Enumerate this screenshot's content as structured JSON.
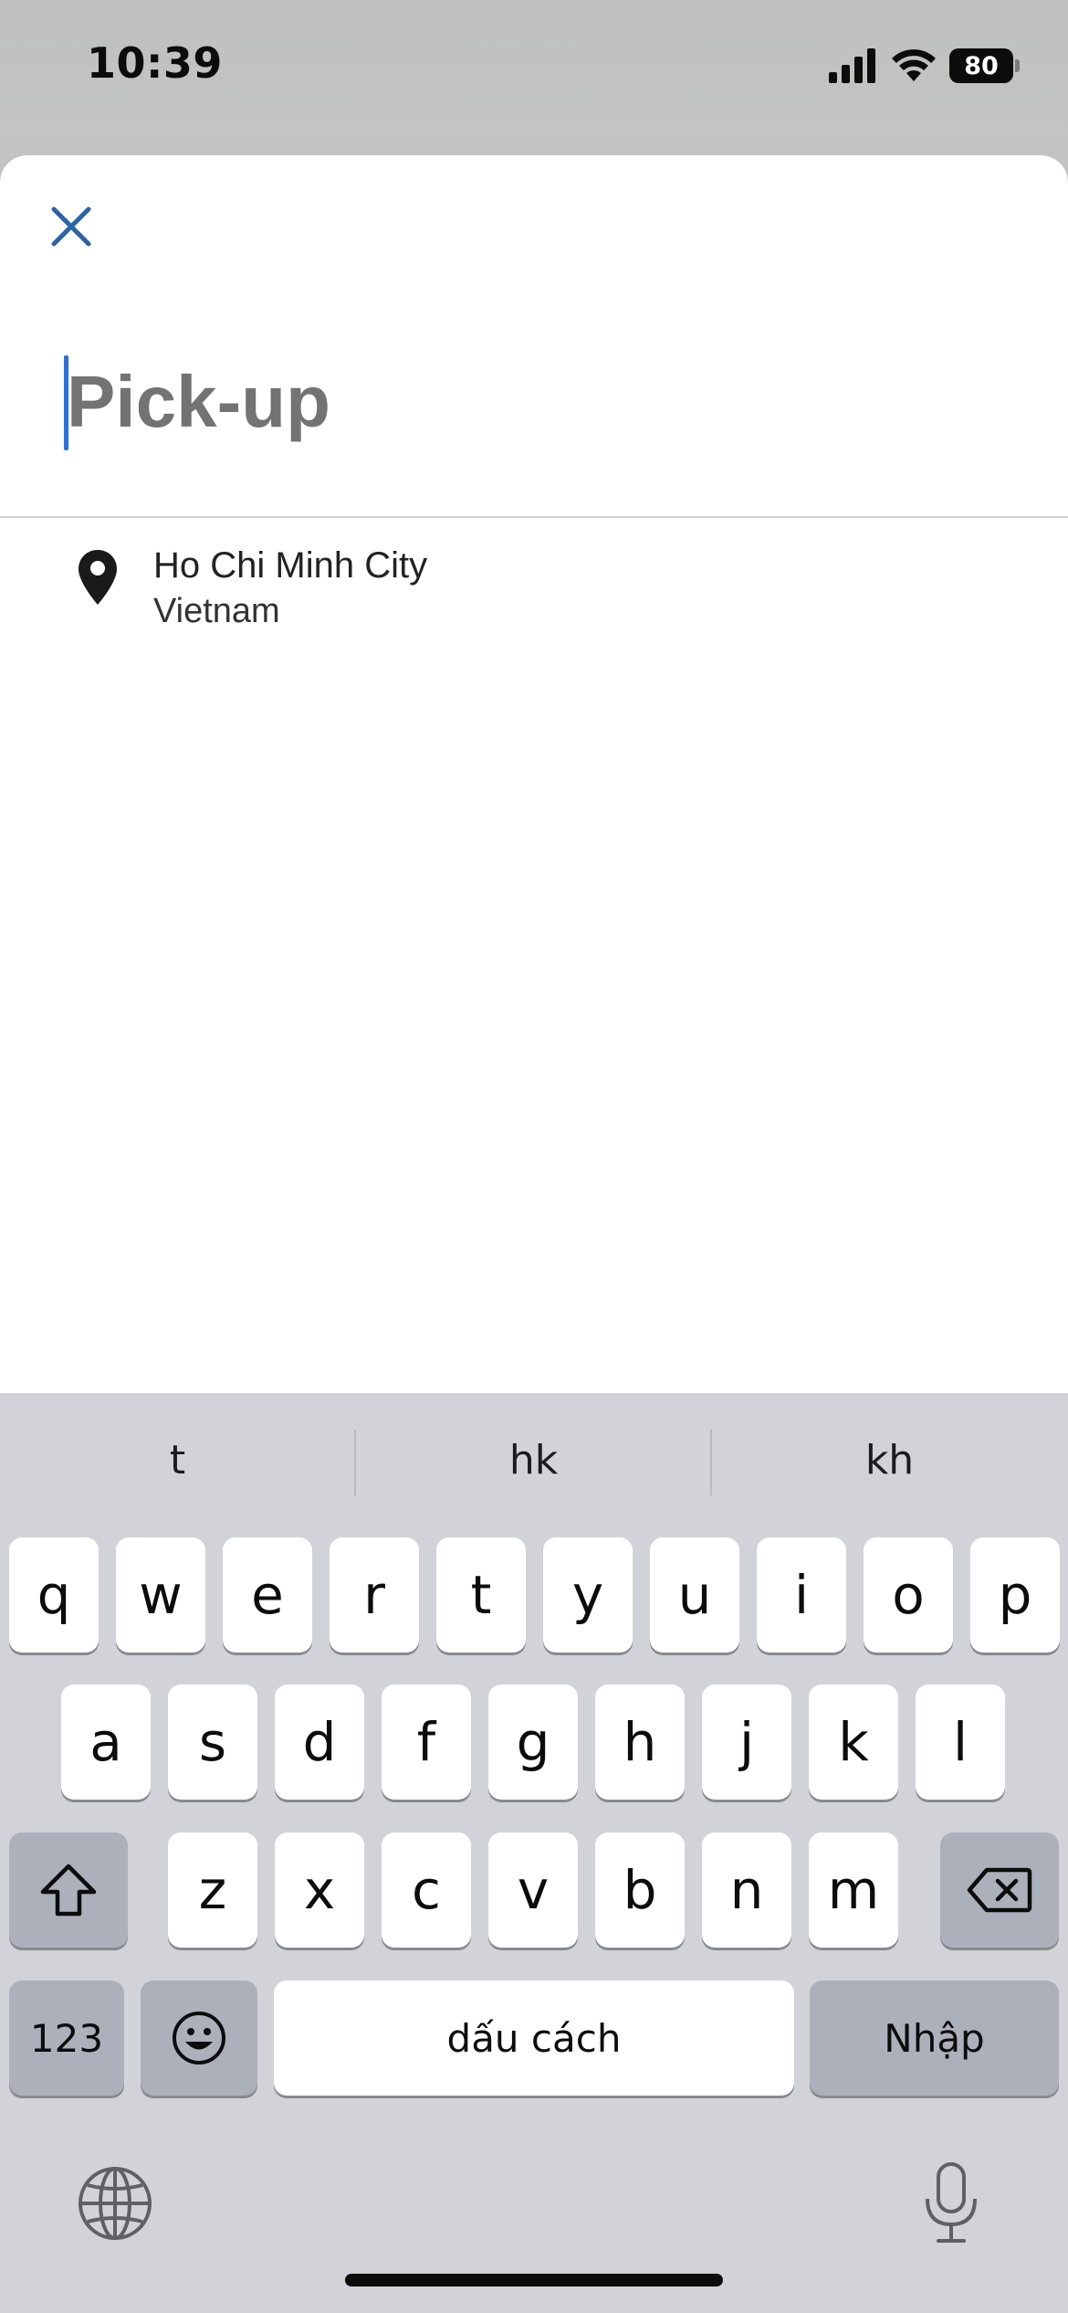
{
  "status_bar": {
    "time": "10:39",
    "battery": "80"
  },
  "search": {
    "placeholder": "Pick-up",
    "value": ""
  },
  "results": [
    {
      "title": "Ho Chi Minh City",
      "subtitle": "Vietnam",
      "icon": "map-pin-icon"
    }
  ],
  "keyboard": {
    "suggestions": [
      "t",
      "hk",
      "kh"
    ],
    "row1": [
      "q",
      "w",
      "e",
      "r",
      "t",
      "y",
      "u",
      "i",
      "o",
      "p"
    ],
    "row2": [
      "a",
      "s",
      "d",
      "f",
      "g",
      "h",
      "j",
      "k",
      "l"
    ],
    "row3": [
      "z",
      "x",
      "c",
      "v",
      "b",
      "n",
      "m"
    ],
    "numbers_label": "123",
    "space_label": "dấu cách",
    "return_label": "Nhập",
    "icons": {
      "shift": "shift-icon",
      "backspace": "backspace-icon",
      "emoji": "emoji-icon",
      "globe": "globe-icon",
      "mic": "microphone-icon"
    }
  },
  "colors": {
    "accent": "#2f6fd8",
    "close_icon": "#2b63a8",
    "keyboard_bg": "#d1d3d9",
    "special_key": "#abb0ba"
  }
}
